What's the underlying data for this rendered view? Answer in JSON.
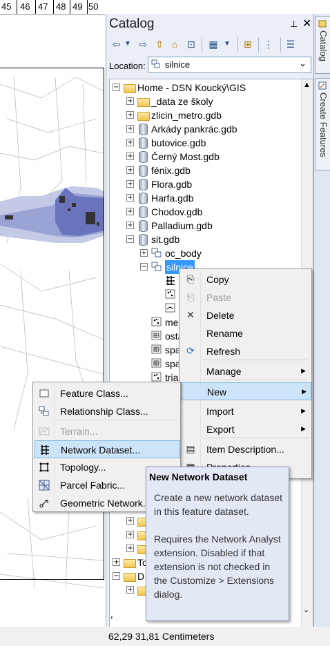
{
  "map": {
    "ruler_ticks": [
      "45",
      "46",
      "47",
      "48",
      "49",
      "50"
    ],
    "status_coords": "62,29  31,81 Centimeters"
  },
  "catalog": {
    "title": "Catalog",
    "pin_glyph": "⊥",
    "close_glyph": "✕",
    "location_label": "Location:",
    "location_value": "silnice",
    "tree": [
      {
        "label": "Home - DSN Koucký\\GIS",
        "type": "home",
        "expander": "−"
      },
      {
        "label": "_data ze školy",
        "type": "folder",
        "expander": "+"
      },
      {
        "label": "zlicin_metro.gdb",
        "type": "folder",
        "expander": "+"
      },
      {
        "label": "Arkády pankrác.gdb",
        "type": "gdb",
        "expander": "+"
      },
      {
        "label": "butovice.gdb",
        "type": "gdb",
        "expander": "+"
      },
      {
        "label": "Černý Most.gdb",
        "type": "gdb",
        "expander": "+"
      },
      {
        "label": "fénix.gdb",
        "type": "gdb",
        "expander": "+"
      },
      {
        "label": "Flora.gdb",
        "type": "gdb",
        "expander": "+"
      },
      {
        "label": "Harfa.gdb",
        "type": "gdb",
        "expander": "+"
      },
      {
        "label": "Chodov.gdb",
        "type": "gdb",
        "expander": "+"
      },
      {
        "label": "Palladium.gdb",
        "type": "gdb",
        "expander": "+"
      },
      {
        "label": "sit.gdb",
        "type": "gdb",
        "expander": "−"
      },
      {
        "label": "oc_body",
        "type": "fds",
        "expander": "+"
      },
      {
        "label": "silnice",
        "type": "fds",
        "expander": "−",
        "selected": true
      },
      {
        "label": "s",
        "type": "network"
      },
      {
        "label": "s",
        "type": "point"
      },
      {
        "label": "s",
        "type": "line"
      },
      {
        "label": "me",
        "type": "point"
      },
      {
        "label": "osta",
        "type": "table"
      },
      {
        "label": "spa",
        "type": "table"
      },
      {
        "label": "spa",
        "type": "table"
      },
      {
        "label": "tria",
        "type": "point"
      }
    ],
    "tree_lower": [
      {
        "label": "C",
        "expander": "+"
      },
      {
        "label": "G",
        "expander": "+"
      },
      {
        "label": "pla",
        "expander": "+"
      },
      {
        "label": "To",
        "expander": "+"
      },
      {
        "label": "D",
        "expander": "−"
      },
      {
        "label": "D",
        "expander": "+"
      }
    ]
  },
  "side_tabs": [
    {
      "label": "Catalog"
    },
    {
      "label": "Create Features"
    }
  ],
  "context_menu": {
    "items": [
      {
        "label": "Copy",
        "icon": "copy-icon"
      },
      {
        "label": "Paste",
        "icon": "paste-icon",
        "disabled": true
      },
      {
        "label": "Delete",
        "icon": "delete-icon"
      },
      {
        "label": "Rename",
        "icon": ""
      },
      {
        "label": "Refresh",
        "icon": "refresh-icon"
      },
      {
        "label": "Manage",
        "submenu": true
      },
      {
        "label": "New",
        "submenu": true,
        "highlighted": true
      },
      {
        "label": "Import",
        "submenu": true
      },
      {
        "label": "Export",
        "submenu": true
      },
      {
        "label": "Item Description...",
        "icon": "document-icon"
      },
      {
        "label": "Properties...",
        "icon": "properties-icon"
      }
    ]
  },
  "new_submenu": {
    "items": [
      {
        "label": "Feature Class...",
        "icon": "feature-class-icon"
      },
      {
        "label": "Relationship Class...",
        "icon": "relationship-class-icon"
      },
      {
        "label": "Terrain...",
        "icon": "terrain-icon",
        "disabled": true
      },
      {
        "label": "Network Dataset...",
        "icon": "network-dataset-icon",
        "highlighted": true
      },
      {
        "label": "Topology...",
        "icon": "topology-icon"
      },
      {
        "label": "Parcel Fabric...",
        "icon": "parcel-fabric-icon"
      },
      {
        "label": "Geometric Network...",
        "icon": "geometric-network-icon"
      }
    ]
  },
  "tooltip": {
    "title": "New Network Dataset",
    "paragraph1": "Create a new network dataset in this feature dataset.",
    "paragraph2": "Requires the Network Analyst extension. Disabled if that extension is not checked in the Customize > Extensions dialog."
  },
  "colors": {
    "selection": "#3399ff",
    "menu_highlight": "#cce4f7",
    "panel_bg": "#e9eef7",
    "polygon_light": "#b8bfe0",
    "polygon_dark": "#6a74bd"
  }
}
